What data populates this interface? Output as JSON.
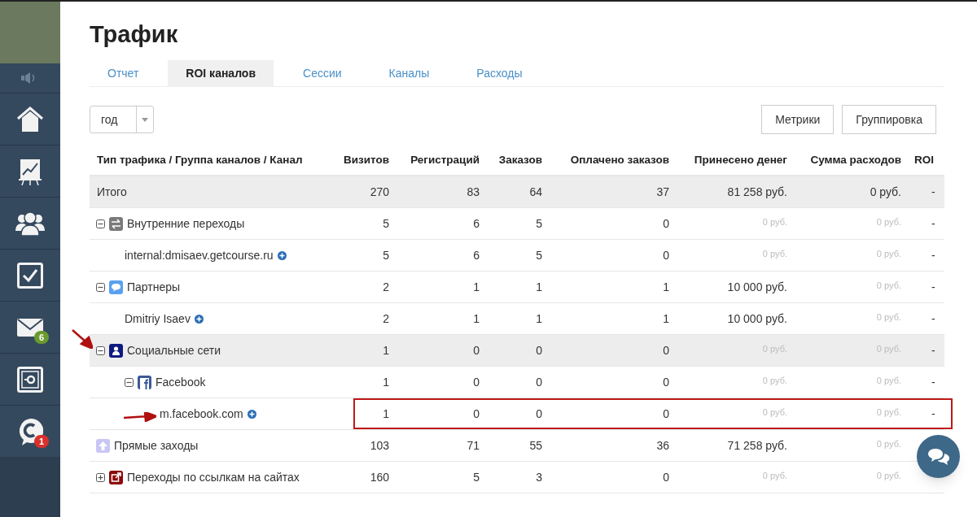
{
  "sidebar": {
    "items": [
      {
        "kind": "sound"
      },
      {
        "kind": "home"
      },
      {
        "kind": "stats"
      },
      {
        "kind": "users"
      },
      {
        "kind": "tasks"
      },
      {
        "kind": "mail",
        "badge": {
          "text": "6",
          "color": "#6a9a2e"
        }
      },
      {
        "kind": "safe"
      },
      {
        "kind": "chat",
        "badge": {
          "text": "1",
          "color": "#d9302c"
        }
      }
    ]
  },
  "title": "Трафик",
  "tabs": [
    {
      "label": "Отчет",
      "selected": false
    },
    {
      "label": "ROI каналов",
      "selected": true
    },
    {
      "label": "Сессии",
      "selected": false
    },
    {
      "label": "Каналы",
      "selected": false
    },
    {
      "label": "Расходы",
      "selected": false
    }
  ],
  "period_select": {
    "value": "год"
  },
  "buttons": [
    "Метрики",
    "Группировка"
  ],
  "table": {
    "columns": [
      "Тип трафика / Группа каналов / Канал",
      "Визитов",
      "Регистраций",
      "Заказов",
      "Оплачено заказов",
      "Принесено денег",
      "Сумма расходов",
      "ROI"
    ],
    "rows": [
      {
        "kind": "total",
        "highlighted": true,
        "outlined": false,
        "arrow": false,
        "cells": [
          {
            "text": "Итого"
          },
          {
            "text": "270",
            "muted": false
          },
          {
            "text": "83",
            "muted": false
          },
          {
            "text": "64",
            "muted": false
          },
          {
            "text": "37",
            "muted": false
          },
          {
            "text": "81 258 руб.",
            "muted": false
          },
          {
            "text": "0 руб.",
            "muted": false
          },
          {
            "text": "-",
            "muted": false
          }
        ]
      },
      {
        "kind": "internal",
        "expandable": true,
        "expanded": true,
        "highlighted": false,
        "outlined": false,
        "arrow": false,
        "cells": [
          {
            "text": "Внутренние переходы"
          },
          {
            "text": "5",
            "muted": false
          },
          {
            "text": "6",
            "muted": false
          },
          {
            "text": "5",
            "muted": false
          },
          {
            "text": "0",
            "muted": false
          },
          {
            "text": "0 руб.",
            "muted": true
          },
          {
            "text": "0 руб.",
            "muted": true
          },
          {
            "text": "-",
            "muted": false
          }
        ],
        "children": [
          {
            "kind": "channel",
            "highlighted": false,
            "outlined": false,
            "arrow": false,
            "cells": [
              {
                "text": "internal:dmisaev.getcourse.ru"
              },
              {
                "text": "5",
                "muted": false
              },
              {
                "text": "6",
                "muted": false
              },
              {
                "text": "5",
                "muted": false
              },
              {
                "text": "0",
                "muted": false
              },
              {
                "text": "0 руб.",
                "muted": true
              },
              {
                "text": "0 руб.",
                "muted": true
              },
              {
                "text": "-",
                "muted": false
              }
            ]
          }
        ]
      },
      {
        "kind": "partner",
        "expandable": true,
        "expanded": true,
        "highlighted": false,
        "outlined": false,
        "arrow": false,
        "cells": [
          {
            "text": "Партнеры"
          },
          {
            "text": "2",
            "muted": false
          },
          {
            "text": "1",
            "muted": false
          },
          {
            "text": "1",
            "muted": false
          },
          {
            "text": "1",
            "muted": false
          },
          {
            "text": "10 000 руб.",
            "muted": false
          },
          {
            "text": "0 руб.",
            "muted": true
          },
          {
            "text": "-",
            "muted": false
          }
        ],
        "children": [
          {
            "kind": "channel",
            "highlighted": false,
            "outlined": false,
            "arrow": false,
            "cells": [
              {
                "text": "Dmitriy Isaev"
              },
              {
                "text": "2",
                "muted": false
              },
              {
                "text": "1",
                "muted": false
              },
              {
                "text": "1",
                "muted": false
              },
              {
                "text": "1",
                "muted": false
              },
              {
                "text": "10 000 руб.",
                "muted": false
              },
              {
                "text": "0 руб.",
                "muted": true
              },
              {
                "text": "-",
                "muted": false
              }
            ]
          }
        ]
      },
      {
        "kind": "social",
        "expandable": true,
        "expanded": true,
        "highlighted": true,
        "outlined": false,
        "arrow": true,
        "cells": [
          {
            "text": "Социальные сети"
          },
          {
            "text": "1",
            "muted": false
          },
          {
            "text": "0",
            "muted": false
          },
          {
            "text": "0",
            "muted": false
          },
          {
            "text": "0",
            "muted": false
          },
          {
            "text": "0 руб.",
            "muted": true
          },
          {
            "text": "0 руб.",
            "muted": true
          },
          {
            "text": "-",
            "muted": false
          }
        ],
        "children": [
          {
            "kind": "facebook",
            "expandable": true,
            "expanded": true,
            "highlighted": false,
            "outlined": false,
            "arrow": false,
            "cells": [
              {
                "text": "Facebook"
              },
              {
                "text": "1",
                "muted": false
              },
              {
                "text": "0",
                "muted": false
              },
              {
                "text": "0",
                "muted": false
              },
              {
                "text": "0",
                "muted": false
              },
              {
                "text": "0 руб.",
                "muted": true
              },
              {
                "text": "0 руб.",
                "muted": true
              },
              {
                "text": "-",
                "muted": false
              }
            ],
            "children": [
              {
                "kind": "channel",
                "highlighted": false,
                "outlined": true,
                "arrow": true,
                "cells": [
                  {
                    "text": "m.facebook.com"
                  },
                  {
                    "text": "1",
                    "muted": false
                  },
                  {
                    "text": "0",
                    "muted": false
                  },
                  {
                    "text": "0",
                    "muted": false
                  },
                  {
                    "text": "0",
                    "muted": false
                  },
                  {
                    "text": "0 руб.",
                    "muted": true
                  },
                  {
                    "text": "0 руб.",
                    "muted": true
                  },
                  {
                    "text": "-",
                    "muted": false
                  }
                ]
              }
            ]
          }
        ]
      },
      {
        "kind": "direct",
        "expandable": false,
        "highlighted": false,
        "outlined": false,
        "arrow": false,
        "cells": [
          {
            "text": "Прямые заходы"
          },
          {
            "text": "103",
            "muted": false
          },
          {
            "text": "71",
            "muted": false
          },
          {
            "text": "55",
            "muted": false
          },
          {
            "text": "36",
            "muted": false
          },
          {
            "text": "71 258 руб.",
            "muted": false
          },
          {
            "text": "0 руб.",
            "muted": true
          }
        ]
      },
      {
        "kind": "referral",
        "expandable": true,
        "expanded": false,
        "highlighted": false,
        "outlined": false,
        "arrow": false,
        "cells": [
          {
            "text": "Переходы по ссылкам на сайтах"
          },
          {
            "text": "160",
            "muted": false
          },
          {
            "text": "5",
            "muted": false
          },
          {
            "text": "3",
            "muted": false
          },
          {
            "text": "0",
            "muted": false
          },
          {
            "text": "0 руб.",
            "muted": true
          },
          {
            "text": "0 руб.",
            "muted": true
          }
        ]
      }
    ]
  }
}
